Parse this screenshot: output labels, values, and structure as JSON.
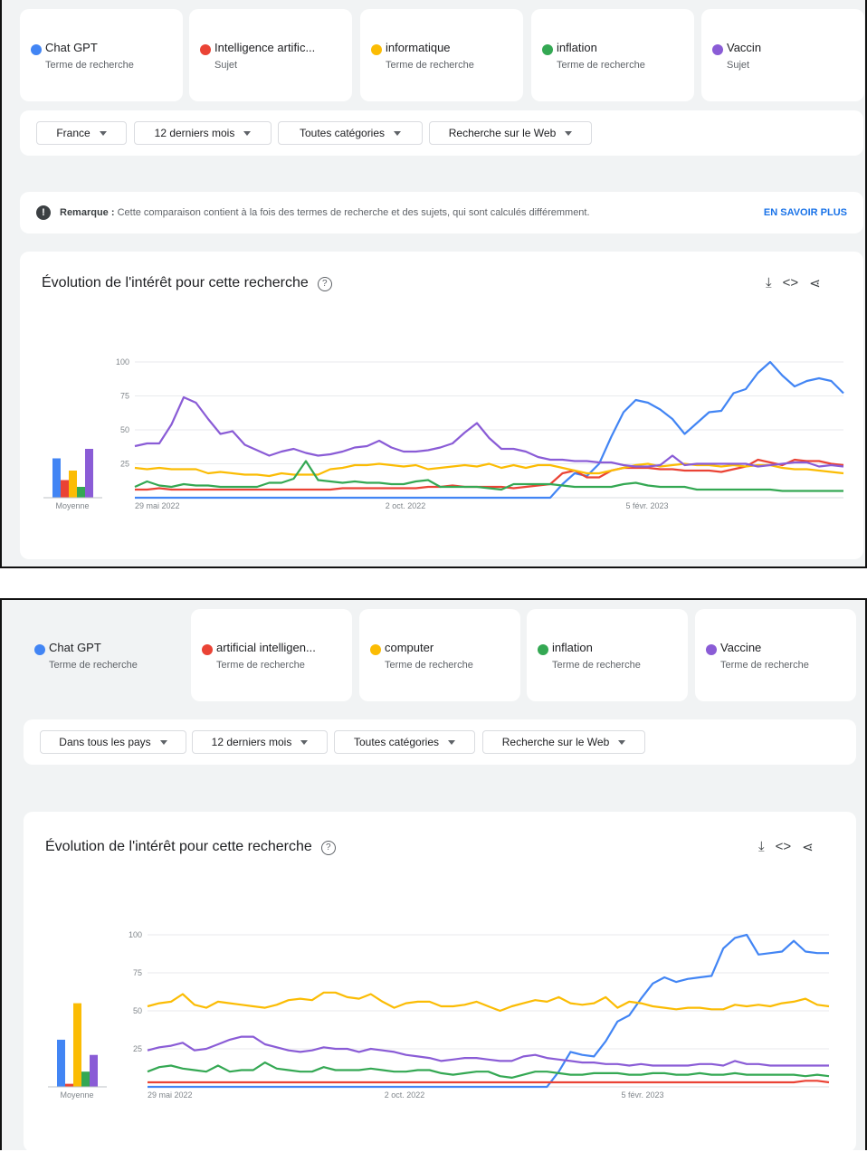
{
  "colors": {
    "blue": "#4285f4",
    "red": "#ea4335",
    "yellow": "#fbbc04",
    "green": "#34a853",
    "purple": "#8a5cd6"
  },
  "panels": [
    {
      "terms": [
        {
          "name": "Chat GPT",
          "type": "Terme de recherche",
          "color": "#4285f4"
        },
        {
          "name": "Intelligence artific...",
          "type": "Sujet",
          "color": "#ea4335"
        },
        {
          "name": "informatique",
          "type": "Terme de recherche",
          "color": "#fbbc04"
        },
        {
          "name": "inflation",
          "type": "Terme de recherche",
          "color": "#34a853"
        },
        {
          "name": "Vaccin",
          "type": "Sujet",
          "color": "#8a5cd6"
        }
      ],
      "filters": [
        "France",
        "12 derniers mois",
        "Toutes catégories",
        "Recherche sur le Web"
      ],
      "note": {
        "label": "Remarque :",
        "text": " Cette comparaison contient à la fois des termes de recherche et des sujets, qui sont calculés différemment.",
        "link": "EN SAVOIR PLUS"
      },
      "chart_title": "Évolution de l'intérêt pour cette recherche"
    },
    {
      "terms": [
        {
          "name": "Chat GPT",
          "type": "Terme de recherche",
          "color": "#4285f4"
        },
        {
          "name": "artificial intelligen...",
          "type": "Terme de recherche",
          "color": "#ea4335"
        },
        {
          "name": "computer",
          "type": "Terme de recherche",
          "color": "#fbbc04"
        },
        {
          "name": "inflation",
          "type": "Terme de recherche",
          "color": "#34a853"
        },
        {
          "name": "Vaccine",
          "type": "Terme de recherche",
          "color": "#8a5cd6"
        }
      ],
      "filters": [
        "Dans tous les pays",
        "12 derniers mois",
        "Toutes catégories",
        "Recherche sur le Web"
      ],
      "chart_title": "Évolution de l'intérêt pour cette recherche"
    }
  ],
  "chart_data": [
    {
      "type": "line",
      "title": "Évolution de l'intérêt pour cette recherche",
      "x_ticks": [
        "29 mai 2022",
        "2 oct. 2022",
        "5 févr. 2023"
      ],
      "y_ticks": [
        25,
        50,
        75,
        100
      ],
      "ylim": [
        0,
        100
      ],
      "average_label": "Moyenne",
      "averages": [
        29,
        13,
        20,
        8,
        36
      ],
      "series": [
        {
          "name": "Chat GPT",
          "color": "#4285f4",
          "values": [
            0,
            0,
            0,
            0,
            0,
            0,
            0,
            0,
            0,
            0,
            0,
            0,
            0,
            0,
            0,
            0,
            0,
            0,
            0,
            0,
            0,
            0,
            0,
            0,
            0,
            0,
            0,
            0,
            0,
            0,
            0,
            0,
            0,
            0,
            0,
            10,
            18,
            16,
            25,
            45,
            63,
            72,
            70,
            65,
            58,
            47,
            55,
            63,
            64,
            77,
            80,
            92,
            100,
            90,
            82,
            86,
            88,
            86,
            77
          ]
        },
        {
          "name": "Intelligence artific...",
          "color": "#ea4335",
          "values": [
            6,
            6,
            7,
            6,
            6,
            6,
            6,
            6,
            6,
            6,
            6,
            6,
            6,
            6,
            6,
            6,
            6,
            7,
            7,
            7,
            7,
            7,
            7,
            7,
            8,
            8,
            9,
            8,
            8,
            8,
            8,
            7,
            8,
            9,
            10,
            18,
            20,
            15,
            15,
            20,
            22,
            22,
            22,
            21,
            21,
            20,
            20,
            20,
            19,
            21,
            23,
            28,
            26,
            24,
            28,
            27,
            27,
            25,
            24
          ]
        },
        {
          "name": "informatique",
          "color": "#fbbc04",
          "values": [
            22,
            21,
            22,
            21,
            21,
            21,
            18,
            19,
            18,
            17,
            17,
            16,
            18,
            17,
            17,
            17,
            21,
            22,
            24,
            24,
            25,
            24,
            23,
            24,
            21,
            22,
            23,
            24,
            23,
            25,
            22,
            24,
            22,
            24,
            24,
            22,
            20,
            18,
            18,
            20,
            22,
            24,
            25,
            23,
            24,
            25,
            24,
            24,
            23,
            24,
            23,
            24,
            24,
            22,
            21,
            21,
            20,
            19,
            18
          ]
        },
        {
          "name": "inflation",
          "color": "#34a853",
          "values": [
            8,
            12,
            9,
            8,
            10,
            9,
            9,
            8,
            8,
            8,
            8,
            11,
            11,
            14,
            27,
            13,
            12,
            11,
            12,
            11,
            11,
            10,
            10,
            12,
            13,
            8,
            8,
            8,
            8,
            7,
            6,
            10,
            10,
            10,
            10,
            9,
            8,
            8,
            8,
            8,
            10,
            11,
            9,
            8,
            8,
            8,
            6,
            6,
            6,
            6,
            6,
            6,
            6,
            5,
            5,
            5,
            5,
            5,
            5
          ]
        },
        {
          "name": "Vaccin",
          "color": "#8a5cd6",
          "values": [
            38,
            40,
            40,
            54,
            74,
            70,
            58,
            47,
            49,
            39,
            35,
            31,
            34,
            36,
            33,
            31,
            32,
            34,
            37,
            38,
            42,
            37,
            34,
            34,
            35,
            37,
            40,
            48,
            55,
            44,
            36,
            36,
            34,
            30,
            28,
            28,
            27,
            27,
            26,
            26,
            24,
            23,
            23,
            24,
            31,
            24,
            25,
            25,
            25,
            25,
            25,
            23,
            24,
            25,
            26,
            26,
            23,
            24,
            23
          ]
        }
      ]
    },
    {
      "type": "line",
      "title": "Évolution de l'intérêt pour cette recherche",
      "x_ticks": [
        "29 mai 2022",
        "2 oct. 2022",
        "5 févr. 2023"
      ],
      "y_ticks": [
        25,
        50,
        75,
        100
      ],
      "ylim": [
        0,
        100
      ],
      "average_label": "Moyenne",
      "averages": [
        31,
        2,
        55,
        10,
        21
      ],
      "series": [
        {
          "name": "Chat GPT",
          "color": "#4285f4",
          "values": [
            0,
            0,
            0,
            0,
            0,
            0,
            0,
            0,
            0,
            0,
            0,
            0,
            0,
            0,
            0,
            0,
            0,
            0,
            0,
            0,
            0,
            0,
            0,
            0,
            0,
            0,
            0,
            0,
            0,
            0,
            0,
            0,
            0,
            0,
            0,
            10,
            23,
            21,
            20,
            30,
            43,
            47,
            58,
            68,
            72,
            69,
            71,
            72,
            73,
            91,
            98,
            100,
            87,
            88,
            89,
            96,
            89,
            88,
            88
          ]
        },
        {
          "name": "artificial intelligen...",
          "color": "#ea4335",
          "values": [
            3,
            3,
            3,
            3,
            3,
            3,
            3,
            3,
            3,
            3,
            3,
            3,
            3,
            3,
            3,
            3,
            3,
            3,
            3,
            3,
            3,
            3,
            3,
            3,
            3,
            3,
            3,
            3,
            3,
            3,
            3,
            3,
            3,
            3,
            3,
            3,
            3,
            3,
            3,
            3,
            3,
            3,
            3,
            3,
            3,
            3,
            3,
            3,
            3,
            3,
            3,
            3,
            3,
            3,
            3,
            3,
            4,
            4,
            3
          ]
        },
        {
          "name": "computer",
          "color": "#fbbc04",
          "values": [
            53,
            55,
            56,
            61,
            54,
            52,
            56,
            55,
            54,
            53,
            52,
            54,
            57,
            58,
            57,
            62,
            62,
            59,
            58,
            61,
            56,
            52,
            55,
            56,
            56,
            53,
            53,
            54,
            56,
            53,
            50,
            53,
            55,
            57,
            56,
            59,
            55,
            54,
            55,
            59,
            52,
            56,
            55,
            53,
            52,
            51,
            52,
            52,
            51,
            51,
            54,
            53,
            54,
            53,
            55,
            56,
            58,
            54,
            53
          ]
        },
        {
          "name": "inflation",
          "color": "#34a853",
          "values": [
            10,
            13,
            14,
            12,
            11,
            10,
            14,
            10,
            11,
            11,
            16,
            12,
            11,
            10,
            10,
            13,
            11,
            11,
            11,
            12,
            11,
            10,
            10,
            11,
            11,
            9,
            8,
            9,
            10,
            10,
            7,
            6,
            8,
            10,
            10,
            9,
            8,
            8,
            9,
            9,
            9,
            8,
            8,
            9,
            9,
            8,
            8,
            9,
            8,
            8,
            9,
            8,
            8,
            8,
            8,
            8,
            7,
            8,
            7
          ]
        },
        {
          "name": "Vaccine",
          "color": "#8a5cd6",
          "values": [
            24,
            26,
            27,
            29,
            24,
            25,
            28,
            31,
            33,
            33,
            28,
            26,
            24,
            23,
            24,
            26,
            25,
            25,
            23,
            25,
            24,
            23,
            21,
            20,
            19,
            17,
            18,
            19,
            19,
            18,
            17,
            17,
            20,
            21,
            19,
            18,
            17,
            16,
            16,
            15,
            15,
            14,
            15,
            14,
            14,
            14,
            14,
            15,
            15,
            14,
            17,
            15,
            15,
            14,
            14,
            14,
            14,
            14,
            14
          ]
        }
      ]
    }
  ]
}
